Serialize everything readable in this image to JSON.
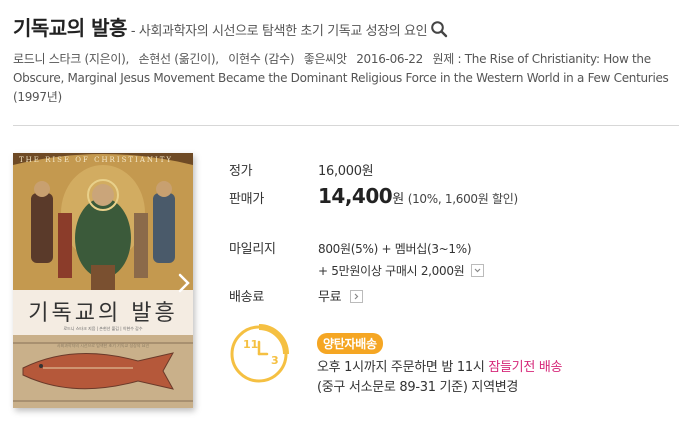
{
  "book": {
    "title": "기독교의 발흥",
    "subtitle": "- 사회과학자의 시선으로 탐색한 초기 기독교 성장의 요인",
    "author": "로드니 스타크 (지은이),",
    "translator1": "손현선 (옮긴이),",
    "supervisor": "이현수 (감수)",
    "publisher": "좋은씨앗",
    "date": "2016-06-22",
    "original_title": "원제 : The Rise of Christianity: How the Obscure, Marginal Jesus Movement Became the Dominant Religious Force in the Western World in a Few Centuries (1997년)"
  },
  "cover": {
    "series": "THE RISE OF CHRISTIANITY",
    "title": "기독교의 발흥",
    "authors": "로드니 스타크 지음 | 손현선 옮김 | 이현수 감수",
    "tagline": "사회과학자의 시선으로 탐색한 초기 기독교 성장의 요인"
  },
  "price": {
    "list_label": "정가",
    "list_value": "16,000원",
    "sale_label": "판매가",
    "sale_value": "14,400",
    "sale_unit": "원",
    "discount": "(10%, 1,600원 할인)"
  },
  "mileage": {
    "label": "마일리지",
    "line1": "800원(5%) + 멤버십(3~1%)",
    "line2": "+ 5만원이상 구매시 2,000원"
  },
  "shipping": {
    "label": "배송료",
    "value": "무료"
  },
  "delivery": {
    "badge": "양탄자배송",
    "line1_prefix": "오후 1시까지 주문하면 밤 11시",
    "line1_accent": "잠들기전 배송",
    "line2": "(중구 서소문로 89-31 기준) 지역변경",
    "clock_11": "11",
    "clock_3": "3"
  },
  "colors": {
    "accent_pink": "#d6297a",
    "badge_orange": "#f5a623",
    "clock_yellow": "#f5c042"
  }
}
